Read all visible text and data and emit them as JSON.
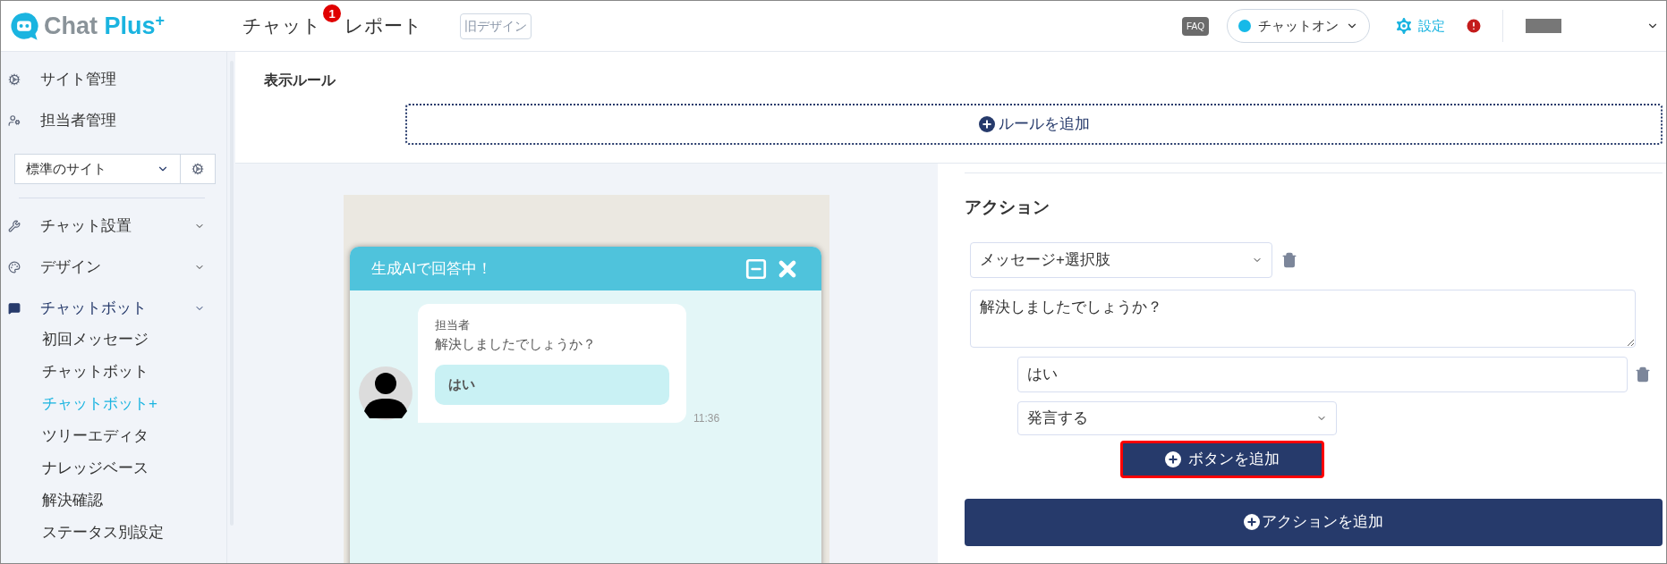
{
  "header": {
    "logo": {
      "name": "Chat Plus",
      "mark": "+"
    },
    "nav": [
      {
        "label": "チャット",
        "badge": "1"
      },
      {
        "label": "レポート"
      }
    ],
    "old_design_button": "旧デザイン",
    "faq": "FAQ",
    "status_toggle": {
      "label": "チャットオン",
      "on": true
    },
    "settings": "設定"
  },
  "sidebar": {
    "top_items": [
      {
        "label": "サイト管理"
      },
      {
        "label": "担当者管理"
      }
    ],
    "site_select": "標準のサイト",
    "menu": [
      {
        "label": "チャット設置"
      },
      {
        "label": "デザイン"
      },
      {
        "label": "チャットボット",
        "children": [
          {
            "label": "初回メッセージ",
            "selected": false
          },
          {
            "label": "チャットボット",
            "selected": false
          },
          {
            "label": "チャットボット+",
            "selected": true
          },
          {
            "label": "ツリーエディタ",
            "selected": false
          },
          {
            "label": "ナレッジベース",
            "selected": false
          },
          {
            "label": "解決確認",
            "selected": false
          },
          {
            "label": "ステータス別設定",
            "selected": false
          }
        ]
      }
    ]
  },
  "main": {
    "section_title": "表示ルール",
    "add_rule_button": "ルールを追加",
    "preview": {
      "title": "生成AIで回答中！",
      "sender": "担当者",
      "message": "解決しましたでしょうか？",
      "choices": [
        "はい"
      ],
      "time": "11:36"
    },
    "action": {
      "title": "アクション",
      "type_select": "メッセージ+選択肢",
      "message": "解決しましたでしょうか？",
      "buttons": [
        {
          "label": "はい",
          "behavior": "発言する"
        }
      ],
      "add_button": {
        "label": "ボタンを追加",
        "highlighted": true
      },
      "add_action_button": "アクションを追加"
    }
  }
}
